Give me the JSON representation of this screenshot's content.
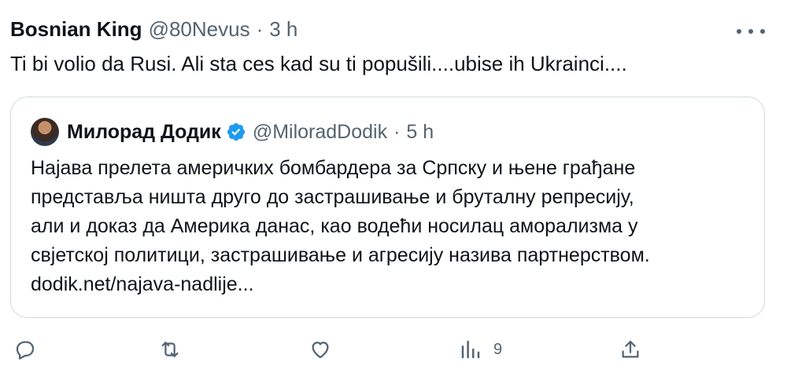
{
  "tweet": {
    "author_name": "Bosnian King",
    "handle": "@80Nevus",
    "separator": "·",
    "time": "3 h",
    "text": "Ti bi volio da Rusi. Ali sta ces kad su ti popušili....ubise ih Ukrainci...."
  },
  "quote": {
    "author_name": "Милорад Додик",
    "handle": "@MiloradDodik",
    "separator": "·",
    "time": "5 h",
    "lines": [
      "Најава прелета америчких бомбардера за Српску и њене грађане",
      "представља ништа друго до застрашивање и бруталну репресију,",
      "али и доказ да Америка данас, као водећи носилац аморализма у",
      "свјетској политици, застрашивање и агресију назива партнерством.",
      "dodik.net/najava-nadlije..."
    ],
    "verified_color": "#1d9bf0"
  },
  "actions": {
    "reply_icon": "reply-icon",
    "retweet_icon": "retweet-icon",
    "like_icon": "heart-icon",
    "views_icon": "views-icon",
    "views_count": "9",
    "share_icon": "share-icon"
  },
  "colors": {
    "text": "#0f1419",
    "secondary": "#536471",
    "border": "#cfd9de"
  }
}
